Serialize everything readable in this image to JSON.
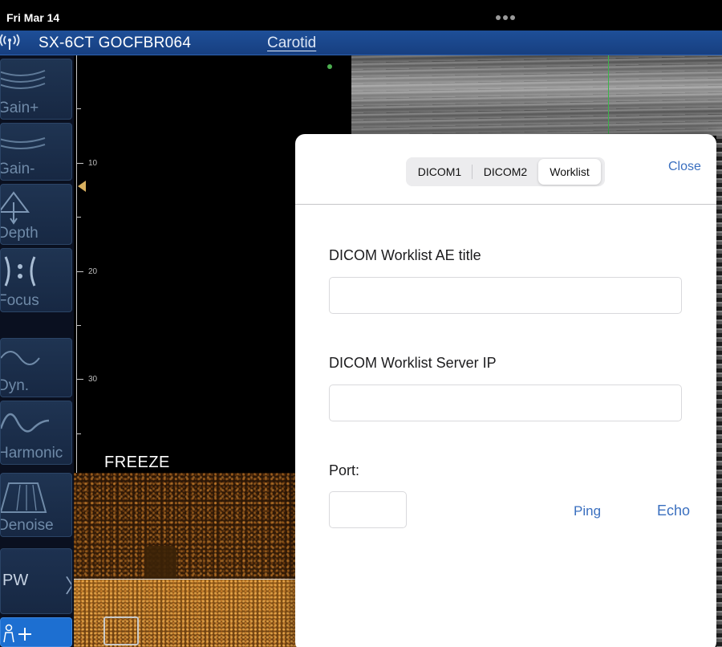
{
  "status_bar": {
    "date": "Fri Mar 14"
  },
  "header": {
    "device_name": "SX-6CT GOCFBR064",
    "preset": "Carotid"
  },
  "left_panel": {
    "controls": [
      {
        "label": "Gain+",
        "icon": "gain-up-icon"
      },
      {
        "label": "Gain-",
        "icon": "gain-down-icon"
      },
      {
        "label": "Depth",
        "icon": "depth-icon"
      },
      {
        "label": "Focus",
        "icon": "focus-icon"
      },
      {
        "label": "Dyn.",
        "icon": "dynamic-range-icon"
      },
      {
        "label": "Harmonic",
        "icon": "harmonic-icon"
      },
      {
        "label": "Denoise",
        "icon": "denoise-icon"
      },
      {
        "label": "PW",
        "icon": "chevron-right-icon"
      }
    ]
  },
  "scale": {
    "ticks": [
      "10",
      "20",
      "30"
    ]
  },
  "image": {
    "freeze_label": "FREEZE"
  },
  "dialog": {
    "tabs": [
      "DICOM1",
      "DICOM2",
      "Worklist"
    ],
    "selected_tab": "Worklist",
    "close_label": "Close",
    "ae_title_label": "DICOM Worklist AE title",
    "ae_title_value": "",
    "server_ip_label": "DICOM Worklist Server IP",
    "server_ip_value": "",
    "port_label": "Port:",
    "port_value": "",
    "ping_label": "Ping",
    "echo_label": "Echo"
  },
  "colors": {
    "accent": "#3a6fbf",
    "title_bar": "#1e4f98",
    "panel": "#1f3452"
  }
}
